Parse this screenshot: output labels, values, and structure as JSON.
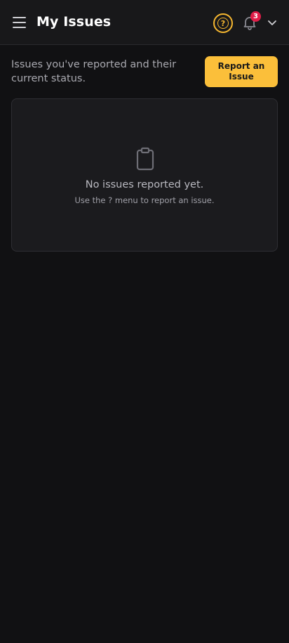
{
  "header": {
    "title": "My Issues",
    "notification_count": "3",
    "help_glyph": "?"
  },
  "intro": {
    "text": "Issues you've reported and their current status.",
    "report_button_label": "Report an Issue"
  },
  "empty_state": {
    "icon": "clipboard-icon",
    "title": "No issues reported yet.",
    "subtitle": "Use the ? menu to report an issue."
  },
  "colors": {
    "background": "#111113",
    "header_bg": "#18181a",
    "accent": "#fbbf3a",
    "badge": "#e11d48",
    "card_bg": "#1b1b1e"
  }
}
